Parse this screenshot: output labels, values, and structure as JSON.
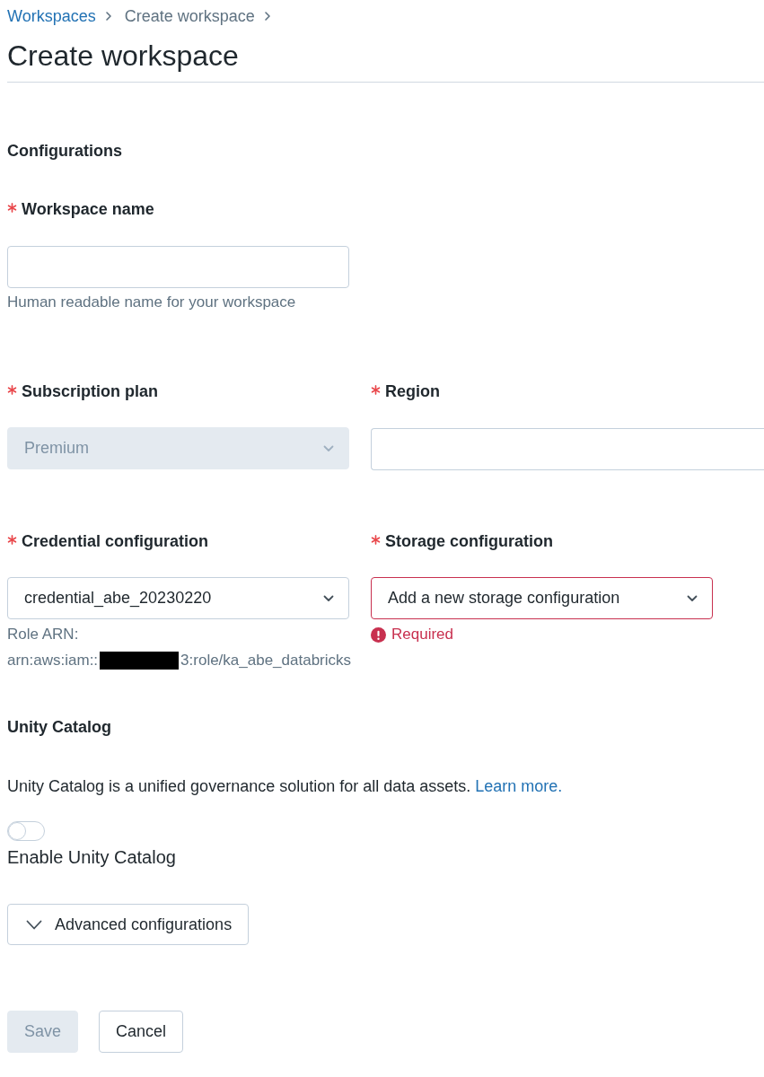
{
  "breadcrumb": [
    {
      "label": "Workspaces",
      "kind": "link"
    },
    {
      "label": "Create workspace",
      "kind": "current"
    }
  ],
  "title": "Create workspace",
  "configurations_heading": "Configurations",
  "field_rows": [
    [
      {
        "kind": "text",
        "label": "Workspace name",
        "required": true,
        "help": "Human readable name for your workspace"
      }
    ],
    [
      {
        "kind": "select",
        "label": "Subscription plan",
        "required": true,
        "value": "Premium",
        "disabled": true
      },
      {
        "kind": "text",
        "label": "Region",
        "required": true
      }
    ],
    [
      {
        "kind": "select",
        "label": "Credential configuration",
        "required": true,
        "value": "credential_abe_20230220",
        "disabled": false,
        "role_arn": {
          "label": "Role ARN:",
          "prefix": "arn:aws:iam::",
          "redacted": true,
          "suffix": "3:role/ka_abe_databricks"
        }
      },
      {
        "kind": "select",
        "label": "Storage configuration",
        "required": true,
        "value": "Add a new storage configuration",
        "disabled": false,
        "error": "Required"
      }
    ]
  ],
  "unity_catalog": {
    "heading": "Unity Catalog",
    "description": "Unity Catalog is a unified governance solution for all data assets.",
    "link": "Learn more.",
    "toggle": {
      "label": "Enable Unity Catalog",
      "on": false
    }
  },
  "advanced_configurations": {
    "label": "Advanced configurations",
    "expanded": false
  },
  "buttons": [
    {
      "label": "Save",
      "kind": "primary",
      "disabled": true
    },
    {
      "label": "Cancel",
      "kind": "secondary",
      "disabled": false
    }
  ]
}
